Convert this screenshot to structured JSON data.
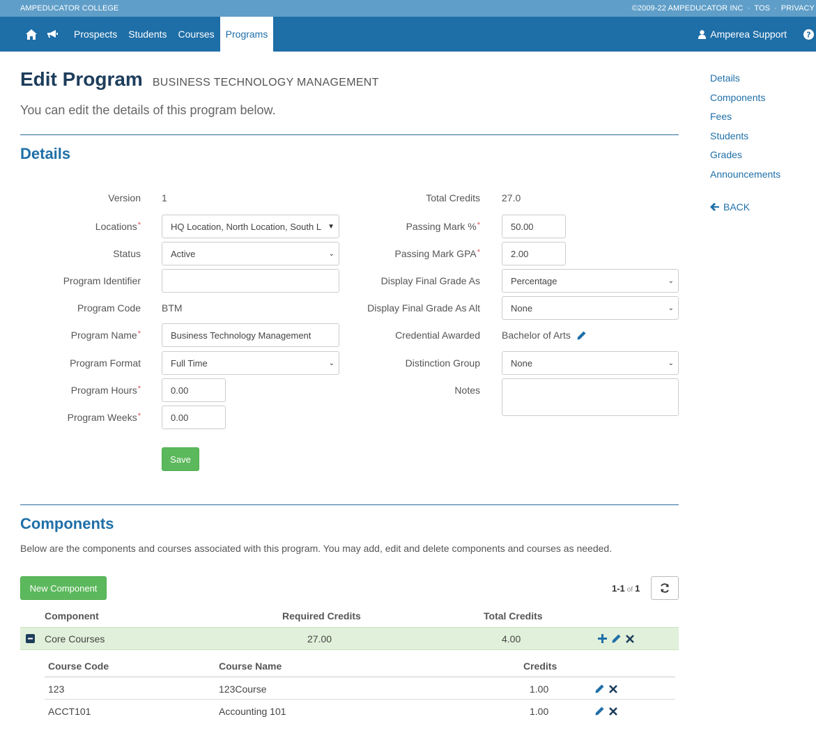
{
  "topbar": {
    "school": "AMPEDUCATOR COLLEGE",
    "copyright": "©2009-22 AMPEDUCATOR INC",
    "tos": "TOS",
    "privacy": "PRIVACY"
  },
  "nav": {
    "items": [
      "Prospects",
      "Students",
      "Courses",
      "Programs"
    ],
    "active": "Programs",
    "user": "Amperea Support"
  },
  "page": {
    "title": "Edit Program",
    "subtitle": "BUSINESS TECHNOLOGY MANAGEMENT",
    "lead": "You can edit the details of this program below."
  },
  "sidenav": {
    "links": [
      "Details",
      "Components",
      "Fees",
      "Students",
      "Grades",
      "Announcements"
    ],
    "back": "BACK"
  },
  "details": {
    "heading": "Details",
    "left": {
      "version_label": "Version",
      "version": "1",
      "locations_label": "Locations",
      "locations": "HQ Location, North Location, South L",
      "status_label": "Status",
      "status": "Active",
      "identifier_label": "Program Identifier",
      "identifier": "",
      "code_label": "Program Code",
      "code": "BTM",
      "name_label": "Program Name",
      "name": "Business Technology Management",
      "format_label": "Program Format",
      "format": "Full Time",
      "hours_label": "Program Hours",
      "hours": "0.00",
      "weeks_label": "Program Weeks",
      "weeks": "0.00"
    },
    "right": {
      "total_credits_label": "Total Credits",
      "total_credits": "27.0",
      "passing_mark_label": "Passing Mark %",
      "passing_mark": "50.00",
      "passing_gpa_label": "Passing Mark GPA",
      "passing_gpa": "2.00",
      "display_final_label": "Display Final Grade As",
      "display_final": "Percentage",
      "display_final_alt_label": "Display Final Grade As Alt",
      "display_final_alt": "None",
      "credential_label": "Credential Awarded",
      "credential": "Bachelor of Arts",
      "distinction_label": "Distinction Group",
      "distinction": "None",
      "notes_label": "Notes",
      "notes": ""
    },
    "save": "Save",
    "required_mark": "*"
  },
  "components": {
    "heading": "Components",
    "description": "Below are the components and courses associated with this program. You may add, edit and delete components and courses as needed.",
    "new_button": "New Component",
    "pager": {
      "range": "1-1",
      "of": "of",
      "total": "1"
    },
    "headers": [
      "Component",
      "Required Credits",
      "Total Credits"
    ],
    "rows": [
      {
        "name": "Core Courses",
        "required_credits": "27.00",
        "total_credits": "4.00",
        "course_headers": [
          "Course Code",
          "Course Name",
          "Credits"
        ],
        "courses": [
          {
            "code": "123",
            "name": "123Course",
            "credits": "1.00"
          },
          {
            "code": "ACCT101",
            "name": "Accounting 101",
            "credits": "1.00"
          }
        ]
      }
    ]
  },
  "colors": {
    "topstrip": "#5f9ec8",
    "nav": "#1e6ea7",
    "accent": "#1f6fa8",
    "green": "#5cb85c",
    "component_row": "#e1f0da"
  }
}
